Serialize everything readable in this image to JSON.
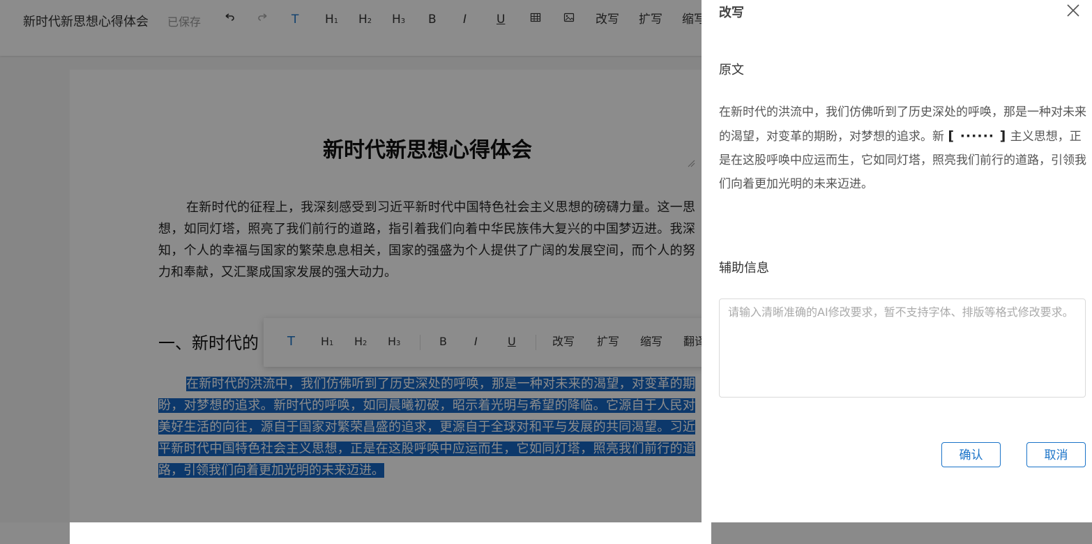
{
  "editor": {
    "doc_title": "新时代新思想心得体会",
    "save_status": "已保存",
    "toolbar": {
      "text": "T",
      "h1": "H",
      "h1_sub": "1",
      "h2": "H",
      "h2_sub": "2",
      "h3": "H",
      "h3_sub": "3",
      "bold": "B",
      "italic": "I",
      "underline": "U",
      "rewrite": "改写",
      "expand": "扩写",
      "shrink": "缩写"
    },
    "heading": "新时代新思想心得体会",
    "paragraph1": "在新时代的征程上，我深刻感受到习近平新时代中国特色社会主义思想的磅礴力量。这一思想，如同灯塔，照亮了我们前行的道路，指引着我们向着中华民族伟大复兴的中国梦迈进。我深知，个人的幸福与国家的繁荣息息相关，国家的强盛为个人提供了广阔的发展空间，而个人的努力和奉献，又汇聚成国家发展的强大动力。",
    "section_heading": "一、新时代的",
    "paragraph2_selected": "在新时代的洪流中，我们仿佛听到了历史深处的呼唤，那是一种对未来的渴望，对变革的期盼，对梦想的追求。新时代的呼唤，如同晨曦初破，昭示着光明与希望的降临。它源自于人民对美好生活的向往，源自于国家对繁荣昌盛的追求，更源自于全球对和平与发展的共同渴望。习近平新时代中国特色社会主义思想，正是在这股呼唤中应运而生，它如同灯塔，照亮我们前行的道路，引领我们向着更加光明的未来迈进。",
    "float_toolbar": {
      "text": "T",
      "h1": "H",
      "h1_sub": "1",
      "h2": "H",
      "h2_sub": "2",
      "h3": "H",
      "h3_sub": "3",
      "bold": "B",
      "italic": "I",
      "underline": "U",
      "rewrite": "改写",
      "expand": "扩写",
      "shrink": "缩写",
      "translate": "翻译"
    }
  },
  "drawer": {
    "title": "改写",
    "original_label": "原文",
    "original_text_start": "在新时代的洪流中，我们仿佛听到了历史深处的呼唤，那是一种对未来的渴望，对变革的期盼，对梦想的追求。新",
    "original_ellipsis": "[ ······ ]",
    "original_text_end": "主义思想，正是在这股呼唤中应运而生，它如同灯塔，照亮我们前行的道路，引领我们向着更加光明的未来迈进。",
    "aux_label": "辅助信息",
    "aux_placeholder": "请输入清晰准确的AI修改要求，暂不支持字体、排版等格式修改要求。",
    "confirm_label": "确认",
    "cancel_label": "取消"
  },
  "colors": {
    "accent": "#1a73c8",
    "selection": "#1766c4"
  }
}
